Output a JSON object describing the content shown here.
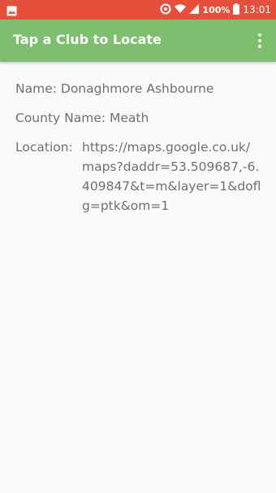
{
  "status_bar": {
    "battery_percent": "100%",
    "time": "13:01",
    "icons": [
      "image-icon",
      "data-saver-icon",
      "wifi-icon",
      "signal-icon",
      "battery-icon"
    ]
  },
  "app_bar": {
    "title": "Tap a Club to Locate",
    "overflow_icon": "more-vert-icon",
    "color": "#7dbf6f"
  },
  "details": {
    "name": "Name: Donaghmore Ashbourne",
    "county": "County Name: Meath",
    "location_label": "Location:",
    "location_url": "https://maps.google.co.uk/maps?daddr=53.509687,-6.409847&t=m&layer=1&doflg=ptk&om=1"
  },
  "colors": {
    "status_bar": "#e54f3c",
    "text": "#6f6f6f",
    "background": "#fafafa"
  }
}
